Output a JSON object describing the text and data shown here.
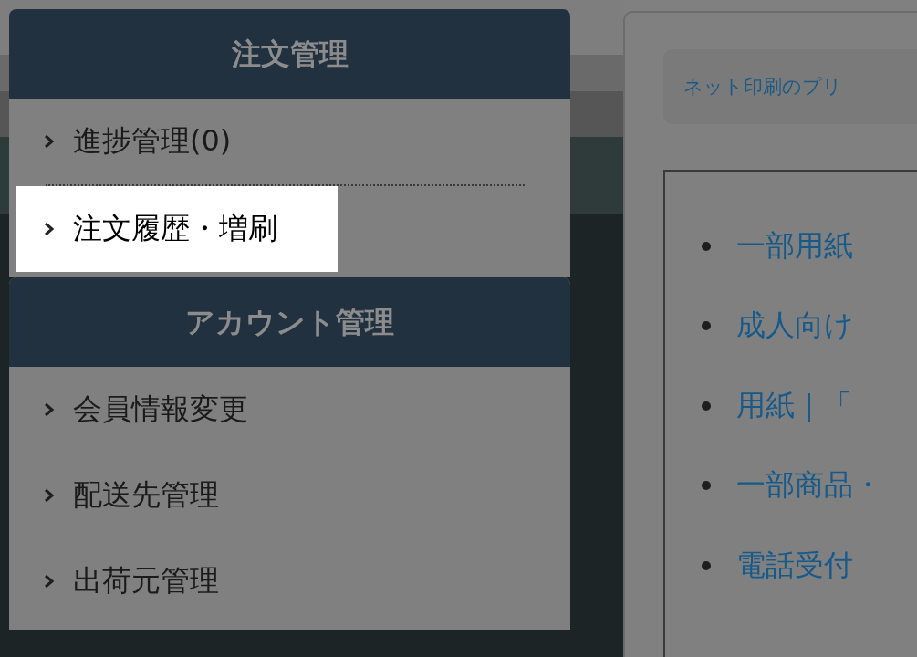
{
  "sidebar": {
    "sections": [
      {
        "title": "注文管理",
        "items": [
          {
            "label": "進捗管理(0)",
            "highlighted": false
          },
          {
            "label": "注文履歴・増刷",
            "highlighted": true
          }
        ]
      },
      {
        "title": "アカウント管理",
        "items": [
          {
            "label": "会員情報変更",
            "highlighted": false
          },
          {
            "label": "配送先管理",
            "highlighted": false
          },
          {
            "label": "出荷元管理",
            "highlighted": false
          }
        ]
      }
    ]
  },
  "main": {
    "notice_link": "ネット印刷のプリ",
    "news": [
      "一部用紙",
      "成人向け",
      "用紙 | 「",
      "一部商品・",
      "電話受付"
    ]
  }
}
